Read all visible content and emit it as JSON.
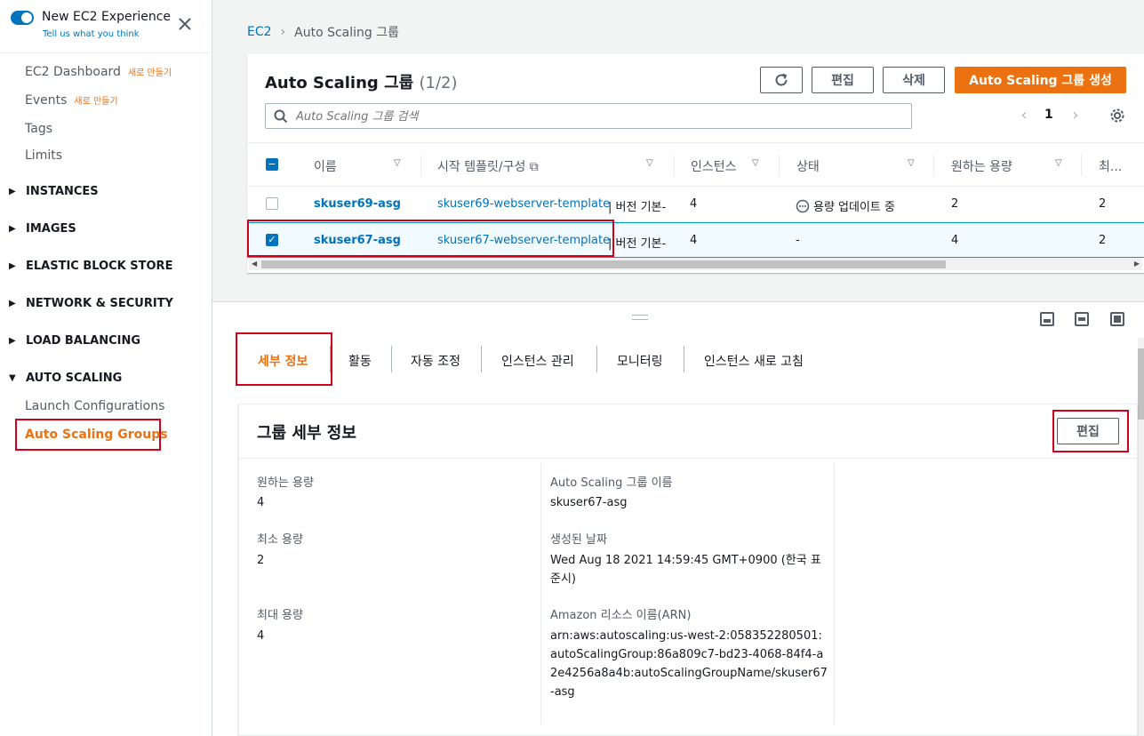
{
  "sidebar": {
    "experience_title": "New EC2 Experience",
    "experience_sub": "Tell us what you think",
    "items": [
      {
        "label": "EC2 Dashboard",
        "badge": "새로 만들기"
      },
      {
        "label": "Events",
        "badge": "새로 만들기"
      },
      {
        "label": "Tags"
      },
      {
        "label": "Limits"
      }
    ],
    "sections": [
      "INSTANCES",
      "IMAGES",
      "ELASTIC BLOCK STORE",
      "NETWORK & SECURITY",
      "LOAD BALANCING",
      "AUTO SCALING"
    ],
    "auto_scaling_items": [
      "Launch Configurations",
      "Auto Scaling Groups"
    ]
  },
  "breadcrumb": {
    "root": "EC2",
    "current": "Auto Scaling 그룹"
  },
  "table_panel": {
    "title": "Auto Scaling 그룹",
    "count": "(1/2)",
    "buttons": {
      "edit": "편집",
      "delete": "삭제",
      "create": "Auto Scaling 그룹 생성"
    },
    "search_placeholder": "Auto Scaling 그룹 검색",
    "page": "1",
    "columns": [
      "이름",
      "시작 템플릿/구성",
      "인스턴스",
      "상태",
      "원하는 용량",
      "최..."
    ],
    "rows": [
      {
        "name": "skuser69-asg",
        "template": "skuser69-webserver-template",
        "version": "| 버전 기본-",
        "instances": "4",
        "status": "용량 업데이트 중",
        "desired": "2",
        "min": "2",
        "selected": false
      },
      {
        "name": "skuser67-asg",
        "template": "skuser67-webserver-template",
        "version": "| 버전 기본-",
        "instances": "4",
        "status": "-",
        "desired": "4",
        "min": "2",
        "selected": true
      }
    ]
  },
  "tabs": [
    "세부 정보",
    "활동",
    "자동 조정",
    "인스턴스 관리",
    "모니터링",
    "인스턴스 새로 고침"
  ],
  "details": {
    "title": "그룹 세부 정보",
    "edit": "편집",
    "desired_label": "원하는 용량",
    "desired_value": "4",
    "min_label": "최소 용량",
    "min_value": "2",
    "max_label": "최대 용량",
    "max_value": "4",
    "name_label": "Auto Scaling 그룹 이름",
    "name_value": "skuser67-asg",
    "created_label": "생성된 날짜",
    "created_value": "Wed Aug 18 2021 14:59:45 GMT+0900 (한국 표준시)",
    "arn_label": "Amazon 리소스 이름(ARN)",
    "arn_value": "arn:aws:autoscaling:us-west-2:058352280501:autoScalingGroup:86a809c7-bd23-4068-84f4-a2e4256a8a4b:autoScalingGroupName/skuser67-asg"
  },
  "colors": {
    "accent": "#ec7211",
    "link": "#0073bb",
    "highlight": "#d0021b"
  }
}
